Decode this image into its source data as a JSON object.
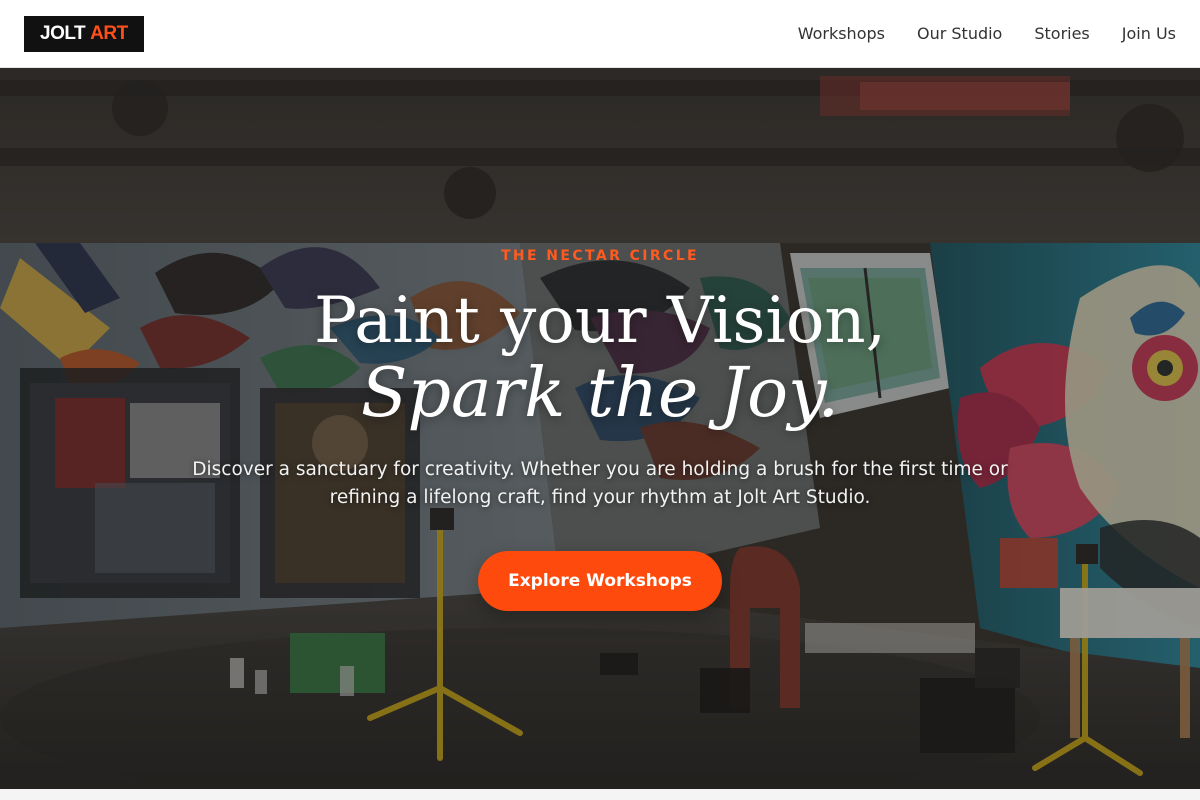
{
  "header": {
    "logo": {
      "word1": "JOLT",
      "word2": "ART"
    },
    "nav": [
      {
        "label": "Workshops"
      },
      {
        "label": "Our Studio"
      },
      {
        "label": "Stories"
      },
      {
        "label": "Join Us"
      }
    ]
  },
  "hero": {
    "kicker": "THE NECTAR CIRCLE",
    "title_line1": "Paint your Vision,",
    "title_line2": "Spark the Joy.",
    "subtitle": "Discover a sanctuary for creativity. Whether you are holding a brush for the first time or refining a lifelong craft, find your rhythm at Jolt Art Studio.",
    "cta_label": "Explore Workshops"
  },
  "colors": {
    "accent": "#ff4a0d",
    "logo_bg": "#111111",
    "nav_text": "#333333"
  }
}
